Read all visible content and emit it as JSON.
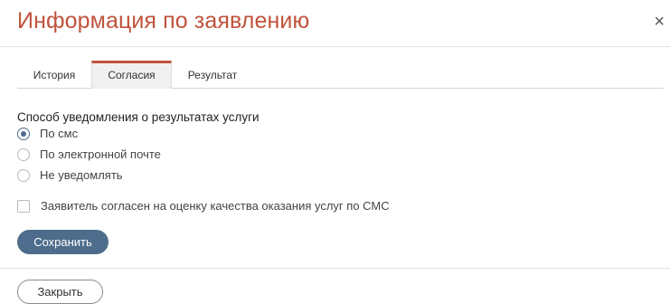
{
  "modal": {
    "title": "Информация по заявлению",
    "close_icon": "close-icon",
    "close_glyph": "×"
  },
  "tabs": [
    {
      "label": "История",
      "active": false
    },
    {
      "label": "Согласия",
      "active": true
    },
    {
      "label": "Результат",
      "active": false
    }
  ],
  "notification": {
    "section_title": "Способ уведомления о результатах услуги",
    "options": [
      {
        "label": "По смс",
        "checked": true
      },
      {
        "label": "По электронной почте",
        "checked": false
      },
      {
        "label": "Не уведомлять",
        "checked": false
      }
    ]
  },
  "consent": {
    "label": "Заявитель согласен на оценку качества оказания услуг по СМС",
    "checked": false
  },
  "buttons": {
    "save_label": "Сохранить",
    "close_label": "Закрыть"
  },
  "colors": {
    "title": "#c0533b",
    "tab_accent": "#c0533b",
    "primary": "#4e6d8c"
  }
}
